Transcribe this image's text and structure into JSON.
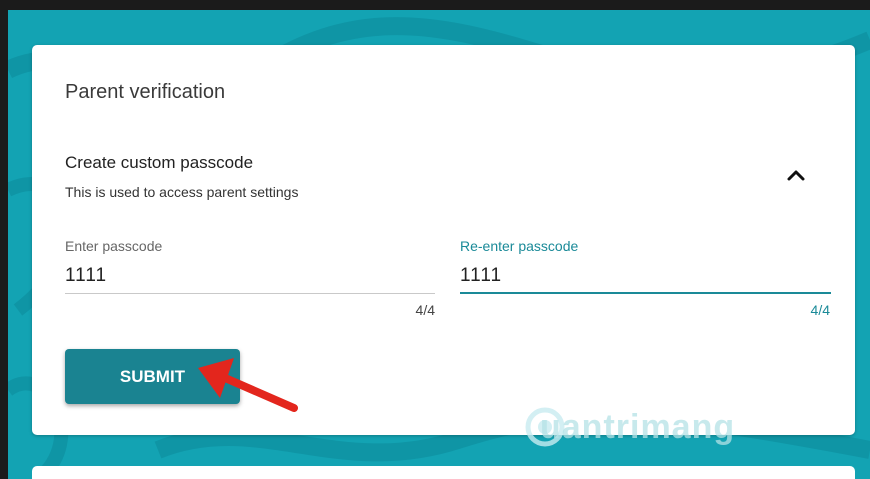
{
  "dialog": {
    "title": "Parent verification",
    "section_title": "Create custom passcode",
    "section_description": "This is used to access parent settings",
    "collapse_icon": "chevron-up-icon"
  },
  "fields": {
    "enter": {
      "label": "Enter passcode",
      "value": "1111",
      "counter": "4/4"
    },
    "reenter": {
      "label": "Re-enter passcode",
      "value": "1111",
      "counter": "4/4"
    }
  },
  "actions": {
    "submit_label": "SUBMIT"
  },
  "watermark": {
    "text": "uantrimang"
  },
  "colors": {
    "background": "#13a3b3",
    "accent": "#1a8a98",
    "button": "#1a8391",
    "arrow": "#e3261d"
  }
}
